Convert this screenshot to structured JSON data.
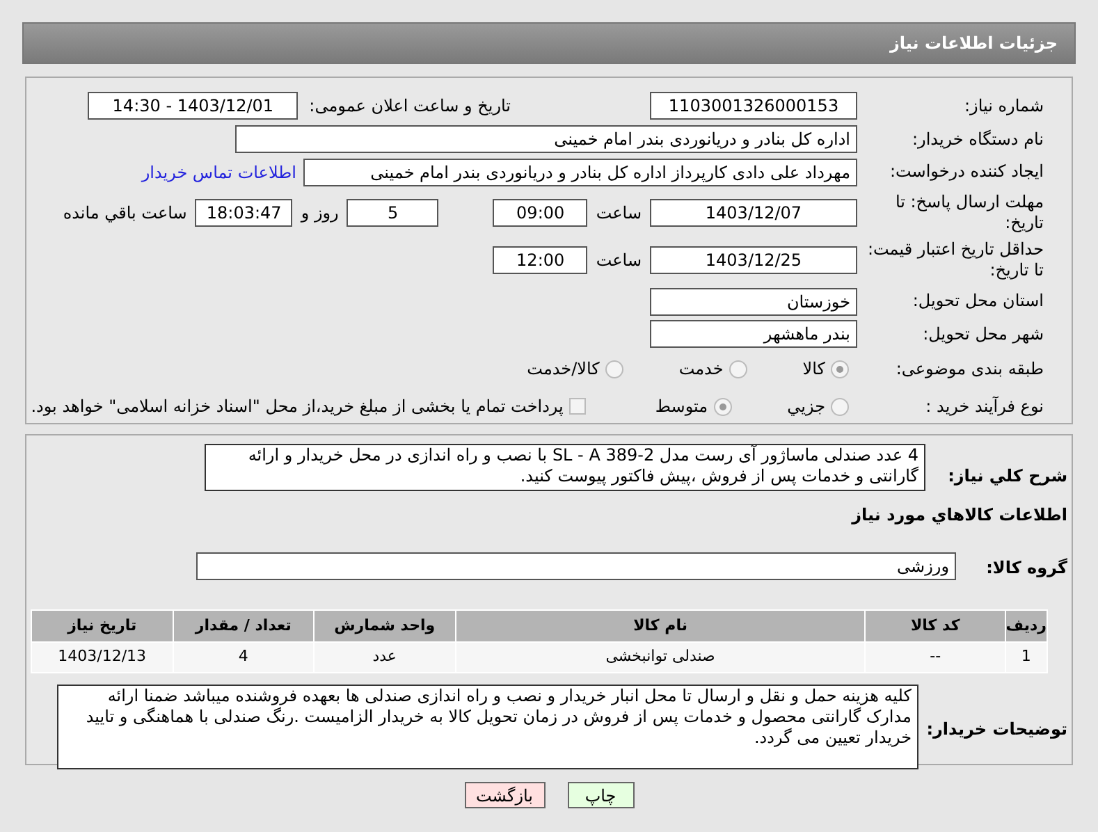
{
  "header": {
    "title": "جزئیات اطلاعات نیاز"
  },
  "need_number": {
    "label": "شماره نیاز:",
    "value": "1103001326000153"
  },
  "announce": {
    "label": "تاریخ و ساعت اعلان عمومی:",
    "value": "1403/12/01 - 14:30"
  },
  "buyer_org": {
    "label": "نام دستگاه خریدار:",
    "value": "اداره کل بنادر و دریانوردی بندر امام خمینی"
  },
  "requester": {
    "label": "ایجاد کننده درخواست:",
    "value": "مهرداد علی دادی کارپرداز اداره کل بنادر و دریانوردی بندر امام خمینی",
    "link": "اطلاعات تماس خریدار"
  },
  "deadline": {
    "label": "مهلت ارسال پاسخ: تا تاریخ:",
    "date": "1403/12/07",
    "time_label": "ساعت",
    "time": "09:00",
    "days": "5",
    "days_label": "روز و",
    "remaining": "18:03:47",
    "remaining_label": "ساعت باقي مانده"
  },
  "validity": {
    "label": "حداقل تاریخ اعتبار قیمت: تا تاریخ:",
    "date": "1403/12/25",
    "time_label": "ساعت",
    "time": "12:00"
  },
  "province": {
    "label": "استان محل تحویل:",
    "value": "خوزستان"
  },
  "city": {
    "label": "شهر محل تحویل:",
    "value": "بندر ماهشهر"
  },
  "category": {
    "label": "طبقه بندی موضوعی:",
    "options": [
      {
        "label": "کالا",
        "selected": true
      },
      {
        "label": "خدمت",
        "selected": false
      },
      {
        "label": "کالا/خدمت",
        "selected": false
      }
    ]
  },
  "purchase_type": {
    "label": "نوع فرآیند خرید :",
    "options": [
      {
        "label": "جزیي",
        "selected": false
      },
      {
        "label": "متوسط",
        "selected": true
      }
    ],
    "payment": {
      "checked": false,
      "label": "پرداخت تمام یا بخشی از مبلغ خرید،از محل \"اسناد خزانه اسلامی\" خواهد بود."
    }
  },
  "description": {
    "label": "شرح کلي نياز:",
    "value": "4 عدد صندلی ماساژور آی رست مدل  SL - A 389-2  با نصب و راه اندازی در محل خریدار و ارائه گارانتی و خدمات پس از فروش ،پیش فاکتور پیوست کنید."
  },
  "goods_title": "اطلاعات کالاهاي مورد نياز",
  "goods_group": {
    "label": "گروه کالا:",
    "value": "ورزشی"
  },
  "table": {
    "columns": [
      "ردیف",
      "کد کالا",
      "نام کالا",
      "واحد شمارش",
      "تعداد / مقدار",
      "تاریخ نیاز"
    ],
    "rows": [
      [
        "1",
        "--",
        "صندلی توانبخشی",
        "عدد",
        "4",
        "1403/12/13"
      ]
    ]
  },
  "notes": {
    "label": "توضیحات خریدار:",
    "value": "کلیه هزینه حمل و نقل و ارسال تا محل انبار خریدار و نصب و راه اندازی صندلی ها بعهده فروشنده میباشد ضمنا ارائه مدارک گارانتی محصول و خدمات پس از فروش در زمان تحویل کالا به خریدار الزامیست .رنگ صندلی با هماهنگی و تایید خریدار تعیین می گردد."
  },
  "buttons": [
    {
      "kind": "print",
      "label": "چاپ"
    },
    {
      "kind": "back",
      "label": "بازگشت"
    }
  ]
}
